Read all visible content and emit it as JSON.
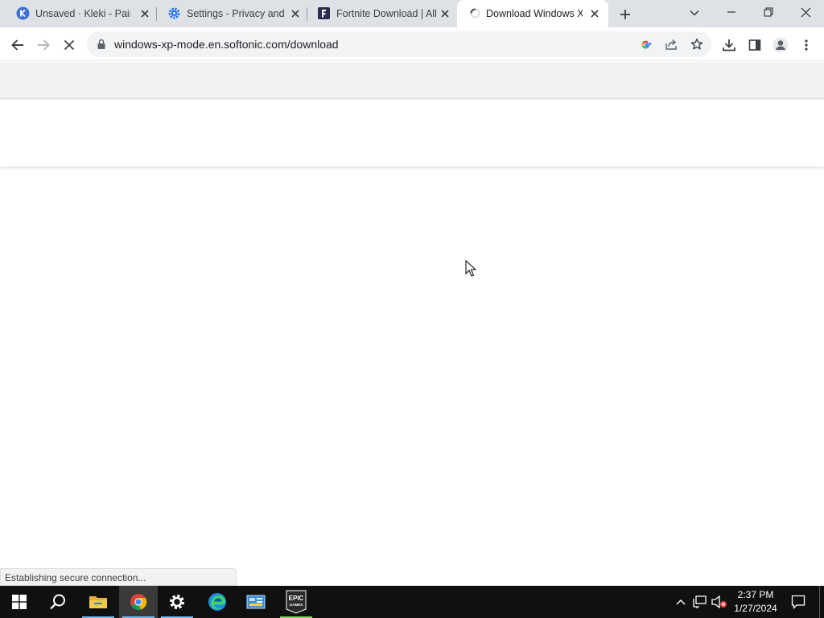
{
  "browser": {
    "tabs": [
      {
        "title": "Unsaved · Kleki - Paint"
      },
      {
        "title": "Settings - Privacy and s"
      },
      {
        "title": "Fortnite Download | All"
      },
      {
        "title": "Download Windows XP",
        "active": true
      }
    ],
    "url": "windows-xp-mode.en.softonic.com/download",
    "status_text": "Establishing secure connection..."
  },
  "taskbar": {
    "apps": [
      "start-icon",
      "search-icon",
      "file-explorer-icon",
      "chrome-icon",
      "settings-icon",
      "edge-icon",
      "control-panel-icon",
      "epic-games-icon"
    ],
    "epic_label_line1": "EPIC",
    "epic_label_line2": "GAMES",
    "time": "2:37 PM",
    "date": "1/27/2024"
  },
  "colors": {
    "tabstrip_bg": "#dee1e6",
    "taskbar_bg": "#101010",
    "accent_blue": "#1a73e8"
  }
}
